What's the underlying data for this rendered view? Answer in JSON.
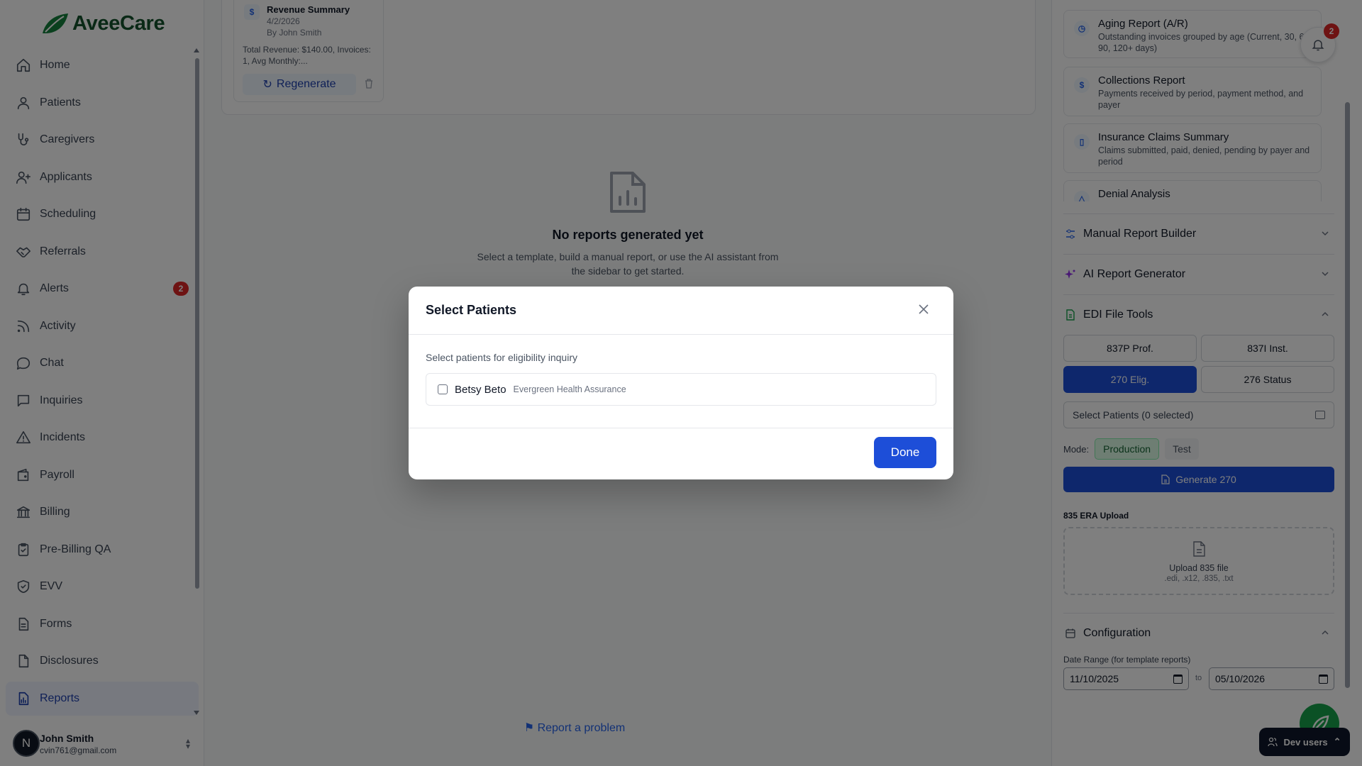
{
  "brand": {
    "name": "AveeCare",
    "accent": "#15803d"
  },
  "sidebar": {
    "items": [
      {
        "label": "Home",
        "icon": "home-icon"
      },
      {
        "label": "Patients",
        "icon": "user-icon"
      },
      {
        "label": "Caregivers",
        "icon": "stethoscope-icon"
      },
      {
        "label": "Applicants",
        "icon": "user-plus-icon"
      },
      {
        "label": "Scheduling",
        "icon": "calendar-icon"
      },
      {
        "label": "Referrals",
        "icon": "handshake-icon"
      },
      {
        "label": "Alerts",
        "icon": "bell-icon",
        "badge": "2"
      },
      {
        "label": "Activity",
        "icon": "rss-icon"
      },
      {
        "label": "Chat",
        "icon": "chat-bubble-icon"
      },
      {
        "label": "Inquiries",
        "icon": "message-square-icon"
      },
      {
        "label": "Incidents",
        "icon": "warning-triangle-icon"
      },
      {
        "label": "Payroll",
        "icon": "wallet-icon"
      },
      {
        "label": "Billing",
        "icon": "bank-icon"
      },
      {
        "label": "Pre-Billing QA",
        "icon": "clipboard-check-icon"
      },
      {
        "label": "EVV",
        "icon": "shield-check-icon"
      },
      {
        "label": "Forms",
        "icon": "file-text-icon"
      },
      {
        "label": "Disclosures",
        "icon": "document-icon"
      },
      {
        "label": "Reports",
        "icon": "file-chart-icon",
        "active": true
      }
    ],
    "user": {
      "initial": "N",
      "name": "John Smith",
      "email": "cvin761@gmail.com"
    }
  },
  "main": {
    "report_card": {
      "icon": "$",
      "title": "Revenue Summary",
      "date": "4/2/2026",
      "by": "By John Smith",
      "stats": "Total Revenue: $140.00, Invoices: 1, Avg Monthly:...",
      "regenerate_label": "Regenerate"
    },
    "empty": {
      "title": "No reports generated yet",
      "subtitle": "Select a template, build a manual report, or use the AI assistant from the sidebar to get started."
    },
    "report_problem_label": "Report a problem"
  },
  "right": {
    "templates": [
      {
        "icon": "clock-icon",
        "symbol": "◷",
        "title": "Aging Report (A/R)",
        "desc": "Outstanding invoices grouped by age (Current, 30, 60, 90, 120+ days)"
      },
      {
        "icon": "dollar-icon",
        "symbol": "$",
        "title": "Collections Report",
        "desc": "Payments received by period, payment method, and payer"
      },
      {
        "icon": "clipboard-icon",
        "symbol": "▯",
        "title": "Insurance Claims Summary",
        "desc": "Claims submitted, paid, denied, pending by payer and period"
      },
      {
        "icon": "warning-icon",
        "symbol": "△",
        "title": "Denial Analysis",
        "desc": ""
      }
    ],
    "notifications": {
      "badge": "2"
    },
    "sections": {
      "manual": "Manual Report Builder",
      "ai": "AI Report Generator",
      "edi": "EDI File Tools",
      "config": "Configuration"
    },
    "edi": {
      "buttons": [
        "837P Prof.",
        "837I Inst.",
        "270 Elig.",
        "276 Status"
      ],
      "active": "270 Elig.",
      "select_patients": "Select Patients (0 selected)",
      "mode_label": "Mode:",
      "mode_production": "Production",
      "mode_test": "Test",
      "generate_label": "Generate 270",
      "era_label": "835 ERA Upload",
      "era_title": "Upload 835 file",
      "era_types": ".edi, .x12, .835, .txt"
    },
    "config": {
      "date_range_label": "Date Range (for template reports)",
      "from": "11/10/2025",
      "to_label": "to",
      "to": "05/10/2026"
    }
  },
  "dev_users_label": "Dev users",
  "modal": {
    "title": "Select Patients",
    "description": "Select patients for eligibility inquiry",
    "patients": [
      {
        "name": "Betsy Beto",
        "payer": "Evergreen Health Assurance",
        "checked": false
      }
    ],
    "done_label": "Done"
  }
}
